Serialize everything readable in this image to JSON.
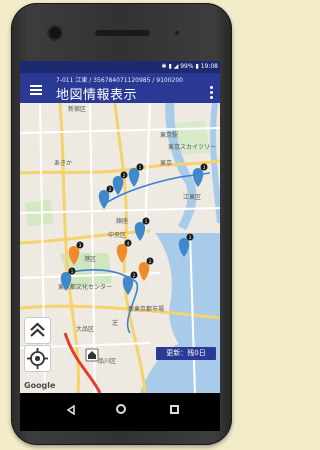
{
  "status_bar": {
    "battery": "99%",
    "time": "19:08"
  },
  "app_bar": {
    "subtitle": "7-011 江東 / 356784071120985 / 9100200",
    "title": "地図情報表示"
  },
  "map": {
    "labels": [
      {
        "id": "shinjuku",
        "text": "新宿区"
      },
      {
        "id": "tokyo_station",
        "text": "東京駅"
      },
      {
        "id": "akihabara",
        "text": "あきか"
      },
      {
        "id": "tokyo_sky",
        "text": "東京スカイツリー"
      },
      {
        "id": "chuo",
        "text": "中央区"
      },
      {
        "id": "higashi_tokyo",
        "text": "東京"
      },
      {
        "id": "ginza",
        "text": "銀座"
      },
      {
        "id": "koto",
        "text": "江東区"
      },
      {
        "id": "minato",
        "text": "港区"
      },
      {
        "id": "shinagawa",
        "text": "品川区"
      },
      {
        "id": "bunka",
        "text": "東京都文化センター"
      },
      {
        "id": "toyosu",
        "text": "新東京都市場"
      },
      {
        "id": "shiba",
        "text": "芝"
      },
      {
        "id": "okura",
        "text": "大品区"
      }
    ],
    "markers": [
      {
        "id": "m1",
        "color": "blue",
        "badge": "3"
      },
      {
        "id": "m2",
        "color": "blue",
        "badge": "2"
      },
      {
        "id": "m3",
        "color": "blue",
        "badge": "2"
      },
      {
        "id": "m4",
        "color": "blue",
        "badge": "1"
      },
      {
        "id": "m5",
        "color": "blue",
        "badge": "3"
      },
      {
        "id": "m6",
        "color": "orange",
        "badge": "3"
      },
      {
        "id": "m7",
        "color": "orange",
        "badge": "4"
      },
      {
        "id": "m8",
        "color": "orange",
        "badge": "2"
      },
      {
        "id": "m9",
        "color": "blue",
        "badge": "1"
      },
      {
        "id": "m10",
        "color": "blue",
        "badge": "2"
      },
      {
        "id": "m11",
        "color": "blue",
        "badge": "1"
      }
    ],
    "update_label": "更新：残0日",
    "attribution": "Google"
  },
  "colors": {
    "app_bar": "#2a3a94",
    "status_bar": "#1d2a70",
    "pin_blue": "#3f88cc",
    "pin_orange": "#ef8b2d",
    "route": "#e0412f",
    "badge": "#1a1a1a"
  },
  "icons": {
    "menu": "hamburger-menu-icon",
    "more": "more-vert-icon",
    "collapse": "double-chevron-up-icon",
    "locate": "my-location-icon",
    "home": "home-marker-icon",
    "nav_back": "triangle-back-icon",
    "nav_home": "circle-home-icon",
    "nav_recent": "square-recents-icon"
  }
}
